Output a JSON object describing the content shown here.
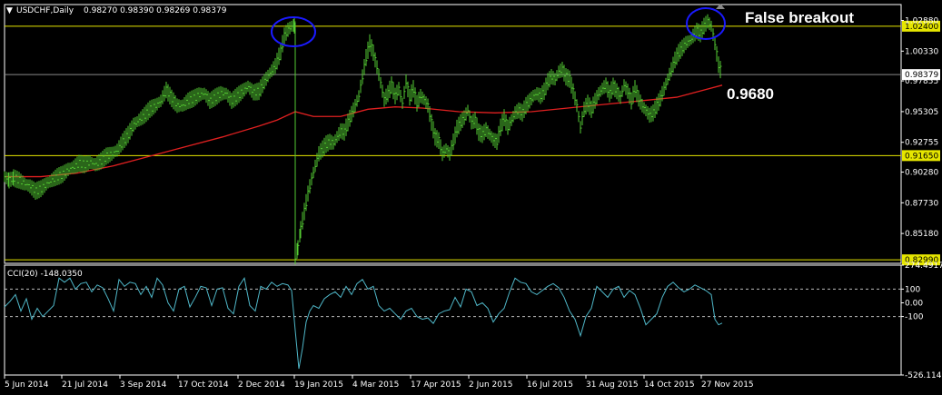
{
  "chart_data": {
    "type": "line",
    "title": "USDCHF,Daily",
    "ohlc_header": "0.98270 0.98390 0.98269 0.98379",
    "colors": {
      "background": "#000000",
      "price": "#55cc33",
      "moving_average": "#e02020",
      "level_lines": "#e6e600",
      "cci_line": "#4fb7c8",
      "frame": "#ffffff",
      "circle": "#1a1aff"
    },
    "x_tick_labels": [
      "5 Jun 2014",
      "21 Jul 2014",
      "3 Sep 2014",
      "17 Oct 2014",
      "2 Dec 2014",
      "19 Jan 2015",
      "4 Mar 2015",
      "17 Apr 2015",
      "2 Jun 2015",
      "16 Jul 2015",
      "31 Aug 2015",
      "14 Oct 2015",
      "27 Nov 2015"
    ],
    "main_panel": {
      "y_range": [
        0.827,
        1.042
      ],
      "y_ticks": [
        "1.02880",
        "1.00330",
        "0.97855",
        "0.95305",
        "0.92755",
        "0.90280",
        "0.87730",
        "0.85180"
      ],
      "price_series": [
        [
          0,
          0.899
        ],
        [
          5,
          0.896
        ],
        [
          10,
          0.898
        ],
        [
          16,
          0.896
        ],
        [
          22,
          0.893
        ],
        [
          28,
          0.891
        ],
        [
          34,
          0.887
        ],
        [
          40,
          0.889
        ],
        [
          46,
          0.893
        ],
        [
          52,
          0.896
        ],
        [
          58,
          0.899
        ],
        [
          64,
          0.901
        ],
        [
          70,
          0.905
        ],
        [
          76,
          0.907
        ],
        [
          82,
          0.91
        ],
        [
          88,
          0.909
        ],
        [
          94,
          0.911
        ],
        [
          100,
          0.909
        ],
        [
          106,
          0.912
        ],
        [
          112,
          0.916
        ],
        [
          118,
          0.918
        ],
        [
          124,
          0.921
        ],
        [
          130,
          0.928
        ],
        [
          136,
          0.934
        ],
        [
          142,
          0.942
        ],
        [
          148,
          0.946
        ],
        [
          154,
          0.95
        ],
        [
          160,
          0.955
        ],
        [
          166,
          0.958
        ],
        [
          172,
          0.962
        ],
        [
          178,
          0.971
        ],
        [
          184,
          0.964
        ],
        [
          190,
          0.958
        ],
        [
          196,
          0.958
        ],
        [
          202,
          0.962
        ],
        [
          208,
          0.964
        ],
        [
          214,
          0.967
        ],
        [
          220,
          0.968
        ],
        [
          226,
          0.962
        ],
        [
          232,
          0.965
        ],
        [
          238,
          0.968
        ],
        [
          244,
          0.968
        ],
        [
          250,
          0.962
        ],
        [
          256,
          0.966
        ],
        [
          262,
          0.97
        ],
        [
          268,
          0.974
        ],
        [
          274,
          0.969
        ],
        [
          280,
          0.97
        ],
        [
          286,
          0.978
        ],
        [
          292,
          0.985
        ],
        [
          298,
          0.991
        ],
        [
          304,
          1.003
        ],
        [
          308,
          1.016
        ],
        [
          312,
          1.021
        ],
        [
          316,
          1.024
        ],
        [
          319,
          1.025
        ],
        [
          320,
          0.832
        ],
        [
          323,
          0.84
        ],
        [
          326,
          0.855
        ],
        [
          330,
          0.87
        ],
        [
          334,
          0.885
        ],
        [
          338,
          0.897
        ],
        [
          342,
          0.908
        ],
        [
          346,
          0.918
        ],
        [
          350,
          0.922
        ],
        [
          354,
          0.926
        ],
        [
          358,
          0.928
        ],
        [
          362,
          0.927
        ],
        [
          366,
          0.932
        ],
        [
          370,
          0.937
        ],
        [
          374,
          0.936
        ],
        [
          378,
          0.944
        ],
        [
          382,
          0.951
        ],
        [
          386,
          0.958
        ],
        [
          390,
          0.966
        ],
        [
          394,
          0.982
        ],
        [
          398,
          0.998
        ],
        [
          402,
          1.01
        ],
        [
          406,
          1.002
        ],
        [
          410,
          0.99
        ],
        [
          414,
          0.977
        ],
        [
          418,
          0.963
        ],
        [
          422,
          0.968
        ],
        [
          426,
          0.975
        ],
        [
          430,
          0.966
        ],
        [
          434,
          0.972
        ],
        [
          438,
          0.96
        ],
        [
          442,
          0.978
        ],
        [
          446,
          0.965
        ],
        [
          450,
          0.972
        ],
        [
          454,
          0.96
        ],
        [
          458,
          0.966
        ],
        [
          462,
          0.963
        ],
        [
          466,
          0.958
        ],
        [
          470,
          0.944
        ],
        [
          474,
          0.932
        ],
        [
          478,
          0.929
        ],
        [
          482,
          0.918
        ],
        [
          486,
          0.922
        ],
        [
          490,
          0.918
        ],
        [
          494,
          0.928
        ],
        [
          498,
          0.939
        ],
        [
          502,
          0.944
        ],
        [
          506,
          0.948
        ],
        [
          510,
          0.954
        ],
        [
          514,
          0.944
        ],
        [
          518,
          0.946
        ],
        [
          522,
          0.936
        ],
        [
          526,
          0.934
        ],
        [
          530,
          0.938
        ],
        [
          534,
          0.934
        ],
        [
          538,
          0.93
        ],
        [
          542,
          0.928
        ],
        [
          546,
          0.94
        ],
        [
          550,
          0.948
        ],
        [
          554,
          0.94
        ],
        [
          558,
          0.946
        ],
        [
          562,
          0.952
        ],
        [
          566,
          0.954
        ],
        [
          570,
          0.952
        ],
        [
          574,
          0.958
        ],
        [
          578,
          0.962
        ],
        [
          582,
          0.966
        ],
        [
          586,
          0.968
        ],
        [
          590,
          0.966
        ],
        [
          594,
          0.97
        ],
        [
          598,
          0.978
        ],
        [
          602,
          0.982
        ],
        [
          606,
          0.98
        ],
        [
          610,
          0.986
        ],
        [
          614,
          0.988
        ],
        [
          618,
          0.982
        ],
        [
          622,
          0.98
        ],
        [
          626,
          0.97
        ],
        [
          630,
          0.958
        ],
        [
          634,
          0.94
        ],
        [
          638,
          0.955
        ],
        [
          642,
          0.96
        ],
        [
          646,
          0.955
        ],
        [
          650,
          0.962
        ],
        [
          654,
          0.968
        ],
        [
          658,
          0.972
        ],
        [
          662,
          0.975
        ],
        [
          666,
          0.968
        ],
        [
          670,
          0.974
        ],
        [
          674,
          0.97
        ],
        [
          678,
          0.965
        ],
        [
          682,
          0.975
        ],
        [
          686,
          0.97
        ],
        [
          690,
          0.962
        ],
        [
          694,
          0.972
        ],
        [
          698,
          0.964
        ],
        [
          702,
          0.958
        ],
        [
          706,
          0.954
        ],
        [
          710,
          0.95
        ],
        [
          714,
          0.952
        ],
        [
          718,
          0.958
        ],
        [
          722,
          0.964
        ],
        [
          726,
          0.972
        ],
        [
          730,
          0.98
        ],
        [
          734,
          0.988
        ],
        [
          738,
          0.996
        ],
        [
          742,
          1.002
        ],
        [
          746,
          1.006
        ],
        [
          750,
          1.01
        ],
        [
          754,
          1.012
        ],
        [
          758,
          1.016
        ],
        [
          762,
          1.02
        ],
        [
          766,
          1.018
        ],
        [
          770,
          1.024
        ],
        [
          774,
          1.028
        ],
        [
          778,
          1.024
        ],
        [
          782,
          1.01
        ],
        [
          786,
          0.992
        ],
        [
          790,
          0.984
        ]
      ],
      "moving_average": [
        [
          0,
          0.899
        ],
        [
          40,
          0.899
        ],
        [
          80,
          0.902
        ],
        [
          120,
          0.908
        ],
        [
          160,
          0.916
        ],
        [
          200,
          0.924
        ],
        [
          240,
          0.932
        ],
        [
          280,
          0.941
        ],
        [
          300,
          0.946
        ],
        [
          320,
          0.953
        ],
        [
          340,
          0.949
        ],
        [
          370,
          0.949
        ],
        [
          400,
          0.955
        ],
        [
          430,
          0.957
        ],
        [
          460,
          0.956
        ],
        [
          500,
          0.953
        ],
        [
          540,
          0.952
        ],
        [
          580,
          0.953
        ],
        [
          620,
          0.956
        ],
        [
          660,
          0.959
        ],
        [
          700,
          0.962
        ],
        [
          740,
          0.965
        ],
        [
          770,
          0.971
        ],
        [
          790,
          0.975
        ]
      ],
      "level_lines": [
        {
          "value": 1.024,
          "label": "1.02400"
        },
        {
          "value": 0.98379,
          "label": "0.98379",
          "color": "#888888"
        },
        {
          "value": 0.9165,
          "label": "0.91650"
        },
        {
          "value": 0.8299,
          "label": "0.82990"
        }
      ],
      "annotations": [
        {
          "text": "False breakout"
        },
        {
          "text": "0.9680"
        }
      ]
    },
    "cci_panel": {
      "label": "CCI(20) -148.0350",
      "y_range": [
        -526.1143,
        274.4917
      ],
      "y_ticks": [
        "274.4917",
        "100",
        "0.00",
        "-100",
        "-526.1143"
      ],
      "reference_levels": [
        100,
        -100
      ],
      "series": [
        [
          0,
          -30
        ],
        [
          6,
          10
        ],
        [
          12,
          60
        ],
        [
          18,
          -60
        ],
        [
          24,
          30
        ],
        [
          30,
          -120
        ],
        [
          36,
          -40
        ],
        [
          42,
          -100
        ],
        [
          48,
          -60
        ],
        [
          54,
          -20
        ],
        [
          60,
          180
        ],
        [
          66,
          150
        ],
        [
          72,
          180
        ],
        [
          78,
          100
        ],
        [
          84,
          140
        ],
        [
          90,
          150
        ],
        [
          96,
          80
        ],
        [
          102,
          130
        ],
        [
          108,
          110
        ],
        [
          114,
          30
        ],
        [
          120,
          -60
        ],
        [
          126,
          170
        ],
        [
          132,
          120
        ],
        [
          138,
          150
        ],
        [
          144,
          140
        ],
        [
          150,
          60
        ],
        [
          156,
          120
        ],
        [
          162,
          40
        ],
        [
          168,
          180
        ],
        [
          174,
          130
        ],
        [
          180,
          0
        ],
        [
          186,
          -60
        ],
        [
          192,
          100
        ],
        [
          198,
          120
        ],
        [
          204,
          -30
        ],
        [
          210,
          40
        ],
        [
          216,
          120
        ],
        [
          222,
          110
        ],
        [
          228,
          -20
        ],
        [
          234,
          100
        ],
        [
          240,
          110
        ],
        [
          246,
          -40
        ],
        [
          252,
          -80
        ],
        [
          258,
          120
        ],
        [
          264,
          180
        ],
        [
          270,
          -20
        ],
        [
          276,
          -60
        ],
        [
          282,
          120
        ],
        [
          288,
          100
        ],
        [
          294,
          150
        ],
        [
          300,
          120
        ],
        [
          306,
          140
        ],
        [
          312,
          130
        ],
        [
          316,
          90
        ],
        [
          320,
          -200
        ],
        [
          324,
          -480
        ],
        [
          328,
          -330
        ],
        [
          332,
          -140
        ],
        [
          336,
          -60
        ],
        [
          340,
          -20
        ],
        [
          346,
          -40
        ],
        [
          352,
          30
        ],
        [
          358,
          60
        ],
        [
          364,
          80
        ],
        [
          370,
          40
        ],
        [
          376,
          120
        ],
        [
          382,
          60
        ],
        [
          388,
          140
        ],
        [
          394,
          170
        ],
        [
          400,
          100
        ],
        [
          406,
          120
        ],
        [
          412,
          -20
        ],
        [
          418,
          -60
        ],
        [
          424,
          -40
        ],
        [
          430,
          -80
        ],
        [
          436,
          -120
        ],
        [
          442,
          -60
        ],
        [
          448,
          -40
        ],
        [
          454,
          -100
        ],
        [
          460,
          -120
        ],
        [
          466,
          -110
        ],
        [
          472,
          -150
        ],
        [
          478,
          -80
        ],
        [
          484,
          -60
        ],
        [
          490,
          -50
        ],
        [
          496,
          40
        ],
        [
          502,
          -30
        ],
        [
          508,
          100
        ],
        [
          514,
          80
        ],
        [
          520,
          -20
        ],
        [
          526,
          0
        ],
        [
          532,
          -40
        ],
        [
          538,
          -140
        ],
        [
          544,
          -80
        ],
        [
          550,
          -40
        ],
        [
          556,
          80
        ],
        [
          562,
          180
        ],
        [
          568,
          150
        ],
        [
          574,
          140
        ],
        [
          580,
          80
        ],
        [
          586,
          60
        ],
        [
          592,
          90
        ],
        [
          598,
          120
        ],
        [
          604,
          140
        ],
        [
          610,
          110
        ],
        [
          616,
          40
        ],
        [
          622,
          -60
        ],
        [
          628,
          -120
        ],
        [
          634,
          -240
        ],
        [
          640,
          -100
        ],
        [
          646,
          -40
        ],
        [
          652,
          120
        ],
        [
          658,
          80
        ],
        [
          664,
          40
        ],
        [
          670,
          100
        ],
        [
          676,
          120
        ],
        [
          682,
          40
        ],
        [
          688,
          90
        ],
        [
          694,
          60
        ],
        [
          700,
          -40
        ],
        [
          706,
          -160
        ],
        [
          712,
          -120
        ],
        [
          718,
          -80
        ],
        [
          724,
          40
        ],
        [
          730,
          120
        ],
        [
          736,
          150
        ],
        [
          742,
          110
        ],
        [
          748,
          80
        ],
        [
          754,
          100
        ],
        [
          760,
          130
        ],
        [
          766,
          110
        ],
        [
          772,
          90
        ],
        [
          778,
          60
        ],
        [
          782,
          -120
        ],
        [
          786,
          -160
        ],
        [
          790,
          -148
        ]
      ]
    }
  },
  "labels": {
    "title": "USDCHF,Daily",
    "ohlc": "0.98270 0.98390 0.98269 0.98379",
    "cci": "CCI(20) -148.0350",
    "false_breakout": "False breakout",
    "level_9680": "0.9680"
  }
}
